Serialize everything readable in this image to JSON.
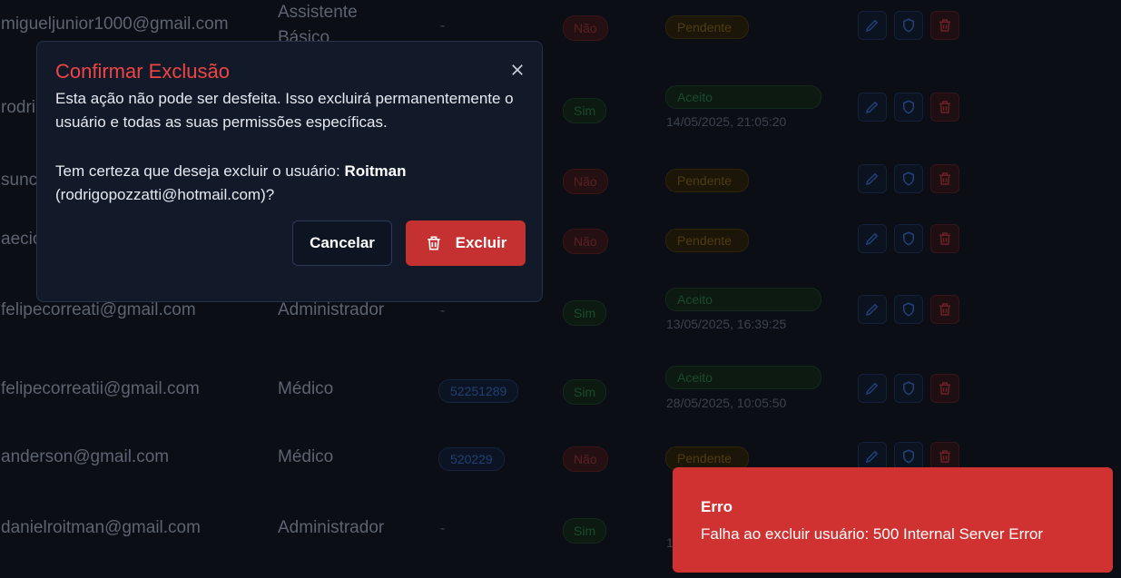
{
  "rows": [
    {
      "email": "migueljunior1000@gmail.com",
      "role": "Assistente Básico",
      "crm": "-",
      "active": "Não",
      "status": "Pendente",
      "date": ""
    },
    {
      "email": "rodri",
      "role": "",
      "crm": "",
      "active": "Sim",
      "status": "Aceito",
      "date": "14/05/2025, 21:05:20"
    },
    {
      "email": "sunc",
      "role": "",
      "crm": "",
      "active": "Não",
      "status": "Pendente",
      "date": ""
    },
    {
      "email": "aecio",
      "role": "",
      "crm": "",
      "active": "Não",
      "status": "Pendente",
      "date": ""
    },
    {
      "email": "felipecorreati@gmail.com",
      "role": "Administrador",
      "crm": "-",
      "active": "Sim",
      "status": "Aceito",
      "date": "13/05/2025, 16:39:25"
    },
    {
      "email": "felipecorreatii@gmail.com",
      "role": "Médico",
      "crm": "52251289",
      "active": "Sim",
      "status": "Aceito",
      "date": "28/05/2025, 10:05:50"
    },
    {
      "email": "anderson@gmail.com",
      "role": "Médico",
      "crm": "520229",
      "active": "Não",
      "status": "Pendente",
      "date": ""
    },
    {
      "email": "danielroitman@gmail.com",
      "role": "Administrador",
      "crm": "-",
      "active": "Sim",
      "status": "",
      "date": "1"
    }
  ],
  "icons": {
    "edit": "pencil-icon",
    "permissions": "shield-icon",
    "delete": "trash-icon",
    "close": "close-icon"
  },
  "modal": {
    "title": "Confirmar Exclusão",
    "description": "Esta ação não pode ser desfeita. Isso excluirá permanentemente o usuário e todas as suas permissões específicas.",
    "confirm_prefix": "Tem certeza que deseja excluir o usuário: ",
    "user_name": "Roitman",
    "user_email": "(rodrigopozzatti@hotmail.com)?",
    "cancel_label": "Cancelar",
    "delete_label": "Excluir"
  },
  "toast": {
    "title": "Erro",
    "message": "Falha ao excluir usuário: 500 Internal Server Error"
  },
  "colors": {
    "danger": "#ef4444",
    "toast_bg": "#d03232",
    "background": "#0b0e15",
    "modal_bg": "#121a2a"
  }
}
